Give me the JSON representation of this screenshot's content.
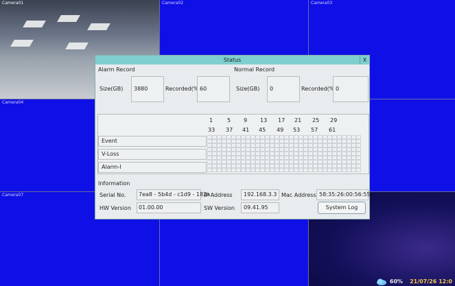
{
  "cameras": [
    {
      "label": "Camera01"
    },
    {
      "label": "Camera02"
    },
    {
      "label": "Camera03"
    },
    {
      "label": "Camera04"
    },
    {
      "label": "Camera07"
    }
  ],
  "hud": {
    "percent": "60%",
    "time": "21/07/26 12:0"
  },
  "dialog": {
    "title": "Status",
    "close": "X",
    "alarm_record": {
      "heading": "Alarm Record",
      "size_label": "Size(GB)",
      "size_value": "3880",
      "recorded_label": "Recorded(%)",
      "recorded_value": "60"
    },
    "normal_record": {
      "heading": "Normal Record",
      "size_label": "Size(GB)",
      "size_value": "0",
      "recorded_label": "Recorded(%)",
      "recorded_value": "0"
    },
    "channels_row1": [
      "1",
      "5",
      "9",
      "13",
      "17",
      "21",
      "25",
      "29"
    ],
    "channels_row2": [
      "33",
      "37",
      "41",
      "45",
      "49",
      "53",
      "57",
      "61"
    ],
    "rows": [
      "Event",
      "V-Loss",
      "Alarm-I"
    ],
    "information": {
      "heading": "Information",
      "serial_label": "Serial No.",
      "serial_value": "7ea8 - 5b4d - c1d9 - 182a",
      "ip_label": "IP Address",
      "ip_value": "192.168.3.3",
      "mac_label": "Mac Address",
      "mac_value": "58:35:26:00:56:55",
      "hw_label": "HW Version",
      "hw_value": "01.00.00",
      "sw_label": "SW Version",
      "sw_value": "09.41.95",
      "system_log_button": "System Log"
    }
  }
}
